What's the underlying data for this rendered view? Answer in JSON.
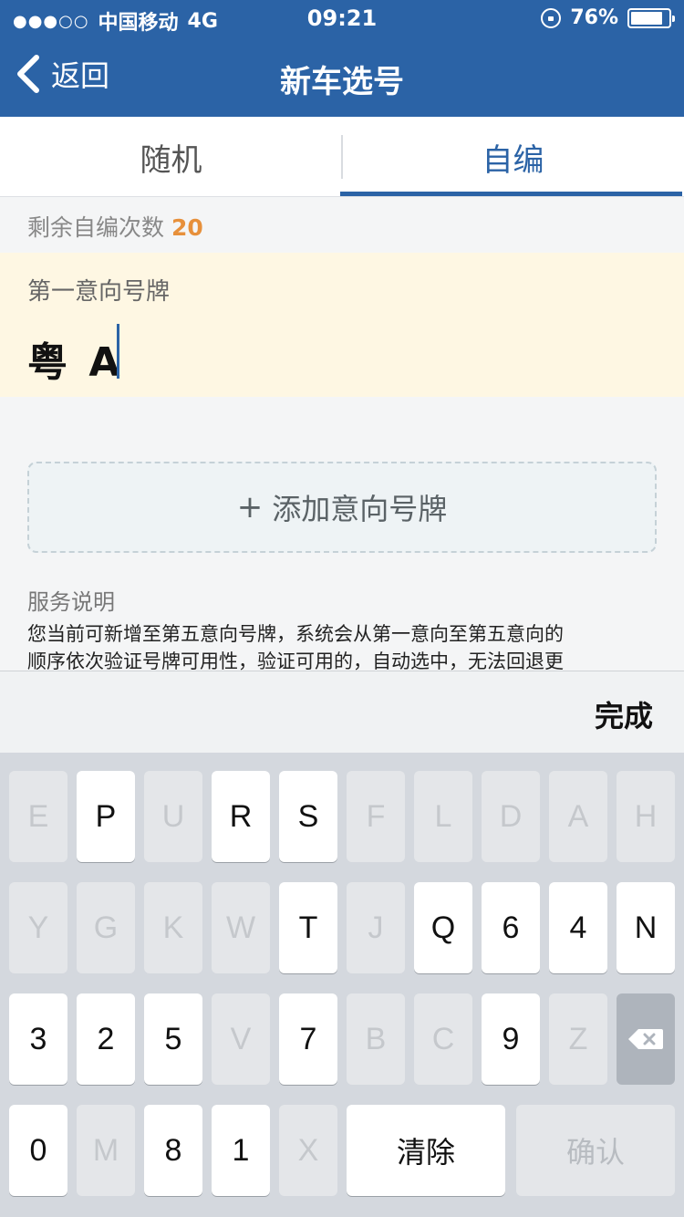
{
  "status_bar": {
    "carrier": "中国移动",
    "network": "4G",
    "time": "09:21",
    "battery": "76%",
    "signal_icon": "signal-dots-icon",
    "lock_icon": "rotation-lock-icon",
    "battery_icon": "battery-icon"
  },
  "nav": {
    "back_label": "返回",
    "title": "新车选号"
  },
  "tabs": {
    "random": "随机",
    "custom": "自编",
    "active": "custom"
  },
  "remaining": {
    "label": "剩余自编次数",
    "count": "20"
  },
  "plate": {
    "label": "第一意向号牌",
    "value": "粤 A"
  },
  "add_plate": {
    "label": "添加意向号牌"
  },
  "service": {
    "title": "服务说明",
    "line1": "您当前可新增至第五意向号牌，系统会从第一意向至第五意向的",
    "line2": "顺序依次验证号牌可用性，验证可用的，自动选中，无法回退更"
  },
  "keyboard": {
    "done": "完成",
    "rows": [
      [
        {
          "k": "E",
          "on": false
        },
        {
          "k": "P",
          "on": true
        },
        {
          "k": "U",
          "on": false
        },
        {
          "k": "R",
          "on": true
        },
        {
          "k": "S",
          "on": true
        },
        {
          "k": "F",
          "on": false
        },
        {
          "k": "L",
          "on": false
        },
        {
          "k": "D",
          "on": false
        },
        {
          "k": "A",
          "on": false
        },
        {
          "k": "H",
          "on": false
        }
      ],
      [
        {
          "k": "Y",
          "on": false
        },
        {
          "k": "G",
          "on": false
        },
        {
          "k": "K",
          "on": false
        },
        {
          "k": "W",
          "on": false
        },
        {
          "k": "T",
          "on": true
        },
        {
          "k": "J",
          "on": false
        },
        {
          "k": "Q",
          "on": true
        },
        {
          "k": "6",
          "on": true
        },
        {
          "k": "4",
          "on": true
        },
        {
          "k": "N",
          "on": true
        }
      ],
      [
        {
          "k": "3",
          "on": true
        },
        {
          "k": "2",
          "on": true
        },
        {
          "k": "5",
          "on": true
        },
        {
          "k": "V",
          "on": false
        },
        {
          "k": "7",
          "on": true
        },
        {
          "k": "B",
          "on": false
        },
        {
          "k": "C",
          "on": false
        },
        {
          "k": "9",
          "on": true
        },
        {
          "k": "Z",
          "on": false
        }
      ],
      [
        {
          "k": "0",
          "on": true
        },
        {
          "k": "M",
          "on": false
        },
        {
          "k": "8",
          "on": true
        },
        {
          "k": "1",
          "on": true
        },
        {
          "k": "X",
          "on": false
        }
      ]
    ],
    "clear": "清除",
    "confirm": "确认",
    "delete_icon": "backspace-icon"
  }
}
